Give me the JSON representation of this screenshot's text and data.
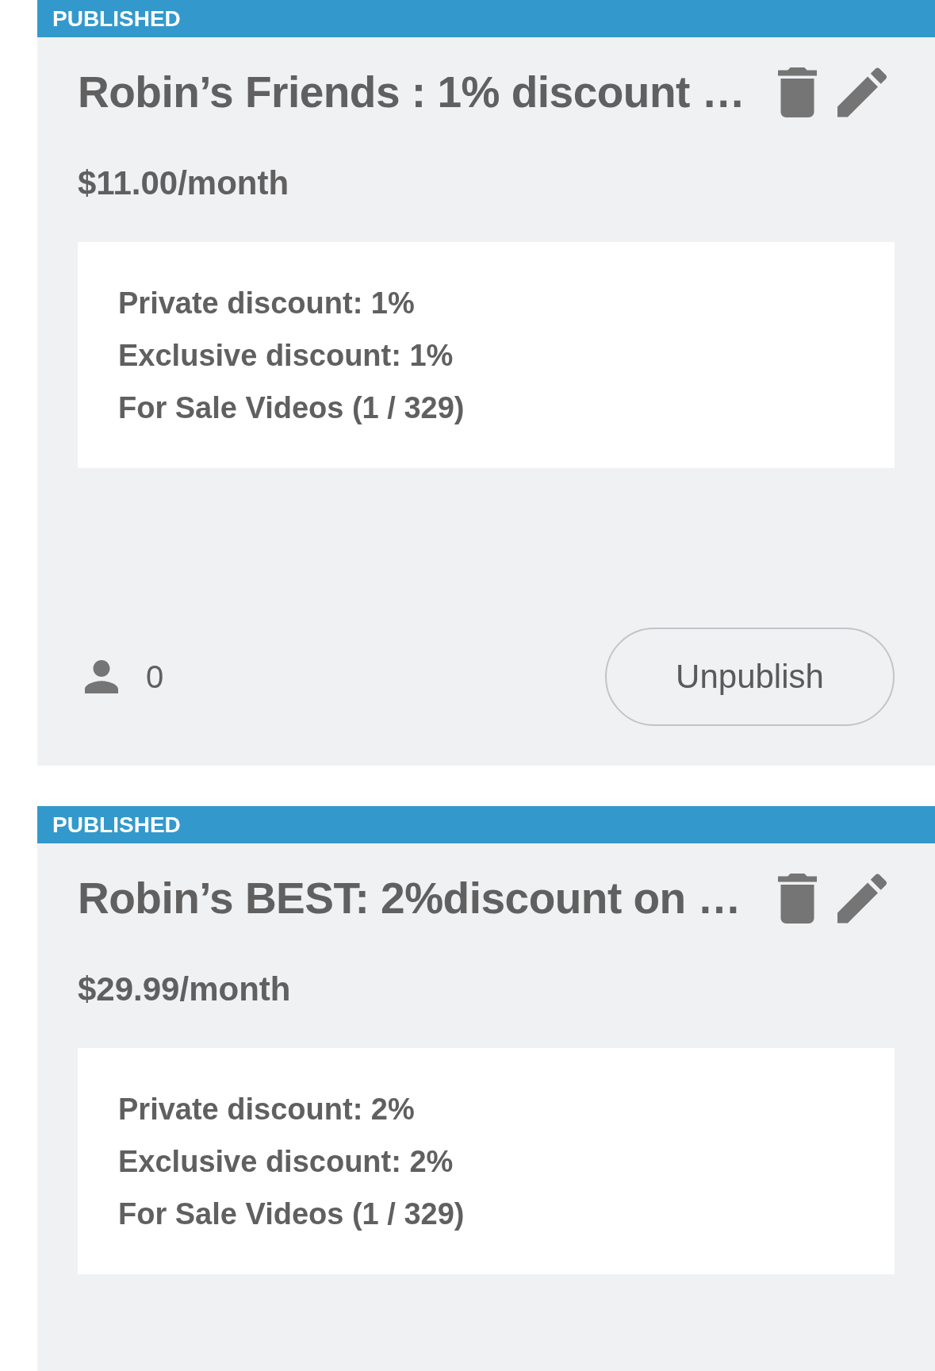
{
  "plans": [
    {
      "status": "PUBLISHED",
      "title": "Robin’s Friends : 1% discount …",
      "price": "$11.00/month",
      "details": [
        "Private discount: 1%",
        "Exclusive discount: 1%",
        "For Sale Videos (1 / 329)"
      ],
      "subscribers": "0",
      "action": "Unpublish"
    },
    {
      "status": "PUBLISHED",
      "title": "Robin’s BEST: 2%discount on …",
      "price": "$29.99/month",
      "details": [
        "Private discount: 2%",
        "Exclusive discount: 2%",
        "For Sale Videos (1 / 329)"
      ]
    }
  ]
}
